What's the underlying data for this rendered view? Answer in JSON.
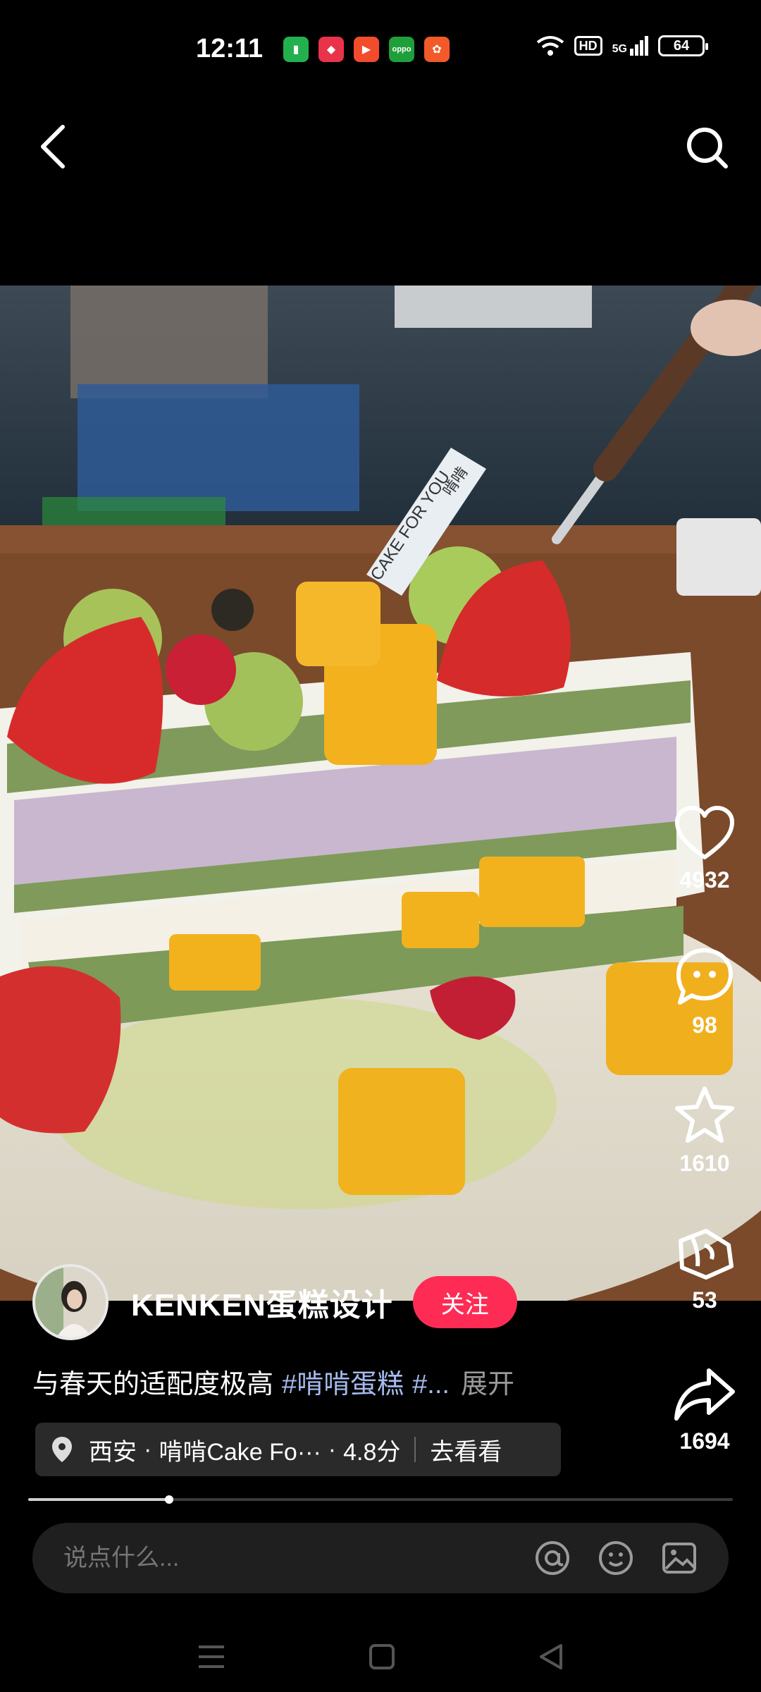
{
  "status_bar": {
    "time": "12:11",
    "network": "5G",
    "hd": "HD",
    "battery": "64"
  },
  "post": {
    "author_name": "KENKEN蛋糕设计",
    "follow_label": "关注",
    "caption_text": "与春天的适配度极高",
    "caption_tag1": "#啃啃蛋糕",
    "caption_tag2": "#...",
    "expand_label": "展开",
    "photo_sticker_text": "CAKE FOR YOU",
    "photo_sticker_brand": "啃啃"
  },
  "location": {
    "city": "西安",
    "place": "啃啃Cake Fo···",
    "rating": "4.8分",
    "action": "去看看"
  },
  "actions": {
    "likes": "4932",
    "comments": "98",
    "favorites": "1610",
    "gifts": "53",
    "shares": "1694"
  },
  "progress": {
    "fraction": 0.2
  },
  "comment_bar": {
    "placeholder": "说点什么..."
  },
  "colors": {
    "follow": "#fe2c55",
    "hashtag": "#a6bcef",
    "background": "#000000"
  }
}
